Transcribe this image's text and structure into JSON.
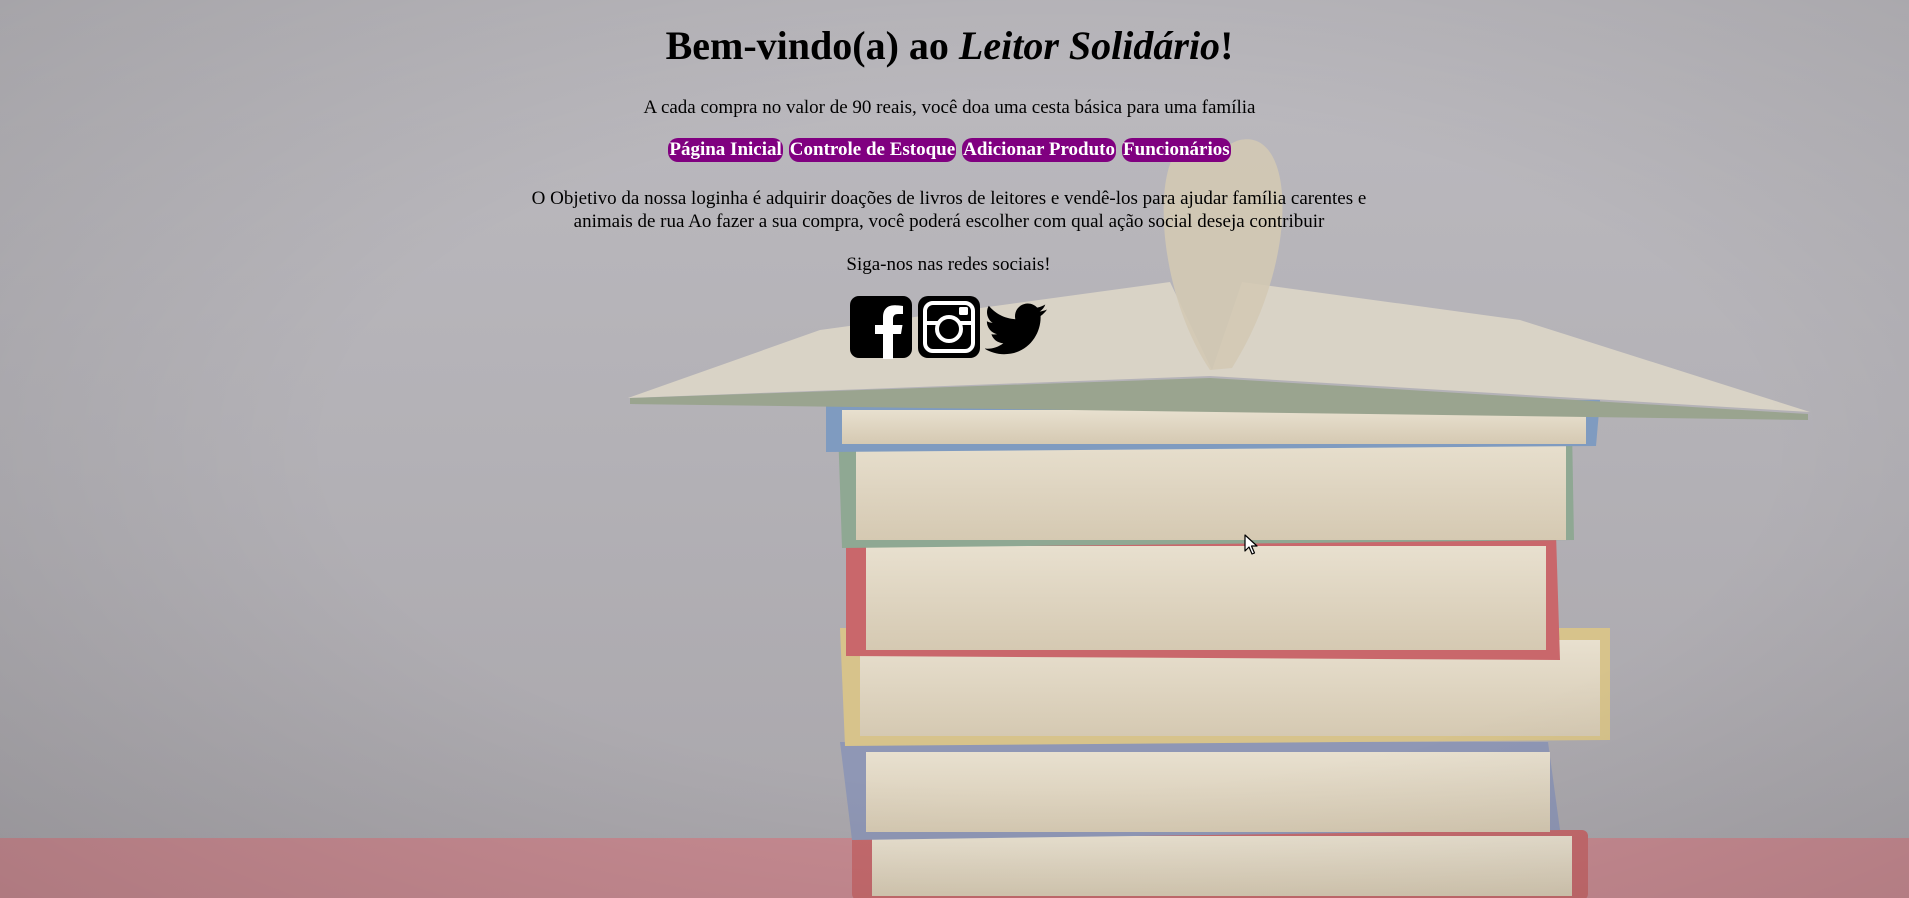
{
  "header": {
    "title_prefix": "Bem-vindo(a) ao ",
    "title_brand": "Leitor Solidário",
    "title_suffix": "!",
    "tagline": "A cada compra no valor de 90 reais, você doa uma cesta básica para uma família"
  },
  "nav": {
    "items": [
      {
        "label": "Página Inicial"
      },
      {
        "label": "Controle de Estoque"
      },
      {
        "label": "Adicionar Produto"
      },
      {
        "label": "Funcionários"
      }
    ],
    "background_color": "#800080",
    "text_color": "#ffffff"
  },
  "about": {
    "text": "O Objetivo da nossa loginha é adquirir doações de livros de leitores e vendê-los para ajudar família carentes e animais de rua Ao fazer a sua compra, você poderá escolher com qual ação social deseja contribuir"
  },
  "social": {
    "heading": "Siga-nos nas redes sociais!",
    "icons": [
      "facebook-icon",
      "instagram-icon",
      "twitter-icon"
    ]
  },
  "background": {
    "image": "stack-of-books-with-heart-shaped-open-book"
  }
}
